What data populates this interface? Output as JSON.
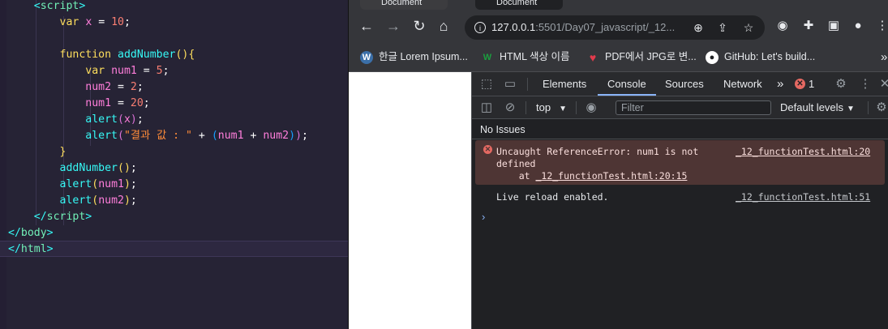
{
  "editor": {
    "lines": [
      [
        {
          "t": "    ",
          "c": ""
        },
        {
          "t": "<",
          "c": "t-br"
        },
        {
          "t": "script",
          "c": "t-tag"
        },
        {
          "t": ">",
          "c": "t-br"
        }
      ],
      [
        {
          "t": "        ",
          "c": ""
        },
        {
          "t": "var",
          "c": "t-kw"
        },
        {
          "t": " ",
          "c": ""
        },
        {
          "t": "x",
          "c": "t-var"
        },
        {
          "t": " = ",
          "c": "t-op"
        },
        {
          "t": "10",
          "c": "t-num"
        },
        {
          "t": ";",
          "c": "t-op"
        }
      ],
      [],
      [
        {
          "t": "        ",
          "c": ""
        },
        {
          "t": "function",
          "c": "t-kw"
        },
        {
          "t": " ",
          "c": ""
        },
        {
          "t": "addNumber",
          "c": "t-fn"
        },
        {
          "t": "(){",
          "c": "t-p1"
        }
      ],
      [
        {
          "t": "            ",
          "c": ""
        },
        {
          "t": "var",
          "c": "t-kw"
        },
        {
          "t": " ",
          "c": ""
        },
        {
          "t": "num1",
          "c": "t-var"
        },
        {
          "t": " = ",
          "c": "t-op"
        },
        {
          "t": "5",
          "c": "t-num"
        },
        {
          "t": ";",
          "c": "t-op"
        }
      ],
      [
        {
          "t": "            ",
          "c": ""
        },
        {
          "t": "num2",
          "c": "t-var"
        },
        {
          "t": " = ",
          "c": "t-op"
        },
        {
          "t": "2",
          "c": "t-num"
        },
        {
          "t": ";",
          "c": "t-op"
        }
      ],
      [
        {
          "t": "            ",
          "c": ""
        },
        {
          "t": "num1",
          "c": "t-var"
        },
        {
          "t": " = ",
          "c": "t-op"
        },
        {
          "t": "20",
          "c": "t-num"
        },
        {
          "t": ";",
          "c": "t-op"
        }
      ],
      [
        {
          "t": "            ",
          "c": ""
        },
        {
          "t": "alert",
          "c": "t-fn"
        },
        {
          "t": "(",
          "c": "t-p2"
        },
        {
          "t": "x",
          "c": "t-var"
        },
        {
          "t": ")",
          "c": "t-p2"
        },
        {
          "t": ";",
          "c": "t-op"
        }
      ],
      [
        {
          "t": "            ",
          "c": ""
        },
        {
          "t": "alert",
          "c": "t-fn"
        },
        {
          "t": "(",
          "c": "t-p2"
        },
        {
          "t": "\"결과 값 : \"",
          "c": "t-str"
        },
        {
          "t": " + ",
          "c": "t-op"
        },
        {
          "t": "(",
          "c": "t-p3"
        },
        {
          "t": "num1",
          "c": "t-var"
        },
        {
          "t": " + ",
          "c": "t-op"
        },
        {
          "t": "num2",
          "c": "t-var"
        },
        {
          "t": ")",
          "c": "t-p3"
        },
        {
          "t": ")",
          "c": "t-p2"
        },
        {
          "t": ";",
          "c": "t-op"
        }
      ],
      [
        {
          "t": "        ",
          "c": ""
        },
        {
          "t": "}",
          "c": "t-p1"
        }
      ],
      [
        {
          "t": "        ",
          "c": ""
        },
        {
          "t": "addNumber",
          "c": "t-fn"
        },
        {
          "t": "()",
          "c": "t-p1"
        },
        {
          "t": ";",
          "c": "t-op"
        }
      ],
      [
        {
          "t": "        ",
          "c": ""
        },
        {
          "t": "alert",
          "c": "t-fn"
        },
        {
          "t": "(",
          "c": "t-p1"
        },
        {
          "t": "num1",
          "c": "t-var"
        },
        {
          "t": ")",
          "c": "t-p1"
        },
        {
          "t": ";",
          "c": "t-op"
        }
      ],
      [
        {
          "t": "        ",
          "c": ""
        },
        {
          "t": "alert",
          "c": "t-fn"
        },
        {
          "t": "(",
          "c": "t-p1"
        },
        {
          "t": "num2",
          "c": "t-var"
        },
        {
          "t": ")",
          "c": "t-p1"
        },
        {
          "t": ";",
          "c": "t-op"
        }
      ],
      [
        {
          "t": "    ",
          "c": ""
        },
        {
          "t": "</",
          "c": "t-br"
        },
        {
          "t": "script",
          "c": "t-tag"
        },
        {
          "t": ">",
          "c": "t-br"
        }
      ],
      [
        {
          "t": "</",
          "c": "t-br"
        },
        {
          "t": "body",
          "c": "t-tag"
        },
        {
          "t": ">",
          "c": "t-br"
        }
      ],
      [
        {
          "t": "</",
          "c": "t-br"
        },
        {
          "t": "html",
          "c": "t-tag"
        },
        {
          "t": ">",
          "c": "t-br"
        }
      ]
    ]
  },
  "browser": {
    "tabs": [
      "Document",
      "Document"
    ],
    "url_host": "127.0.0.1",
    "url_rest": ":5501/Day07_javascript/_12...",
    "bookmarks": [
      {
        "label": "한글 Lorem Ipsum...",
        "icon": "wordpress-icon",
        "fav": "W",
        "color": "#3b6fa8"
      },
      {
        "label": "HTML 색상 이름",
        "icon": "w-logo-icon",
        "fav": "W",
        "color": "#1b9e3e"
      },
      {
        "label": "PDF에서 JPG로 변...",
        "icon": "heart-icon",
        "fav": "♥",
        "color": "#e23b4c"
      },
      {
        "label": "GitHub: Let's build...",
        "icon": "github-icon",
        "fav": "●",
        "color": "#ffffff"
      }
    ],
    "bookmarks_more": "»"
  },
  "devtools": {
    "tabs": [
      "Elements",
      "Console",
      "Sources",
      "Network"
    ],
    "active_tab": "Console",
    "more_tabs": "»",
    "error_count": "1",
    "context": "top",
    "filter_placeholder": "Filter",
    "levels": "Default levels",
    "issues": "No Issues",
    "error_message": "Uncaught ReferenceError: num1 is not\ndefined\n    at ",
    "error_stack_link": "_12_functionTest.html:20:15",
    "error_source": "_12_functionTest.html:20",
    "log_message": "Live reload enabled.",
    "log_source": "_12_functionTest.html:51",
    "prompt": "›"
  },
  "colors": {
    "editor_bg": "#262335",
    "error_bg": "#4e3534",
    "accent": "#8ab4f8"
  }
}
